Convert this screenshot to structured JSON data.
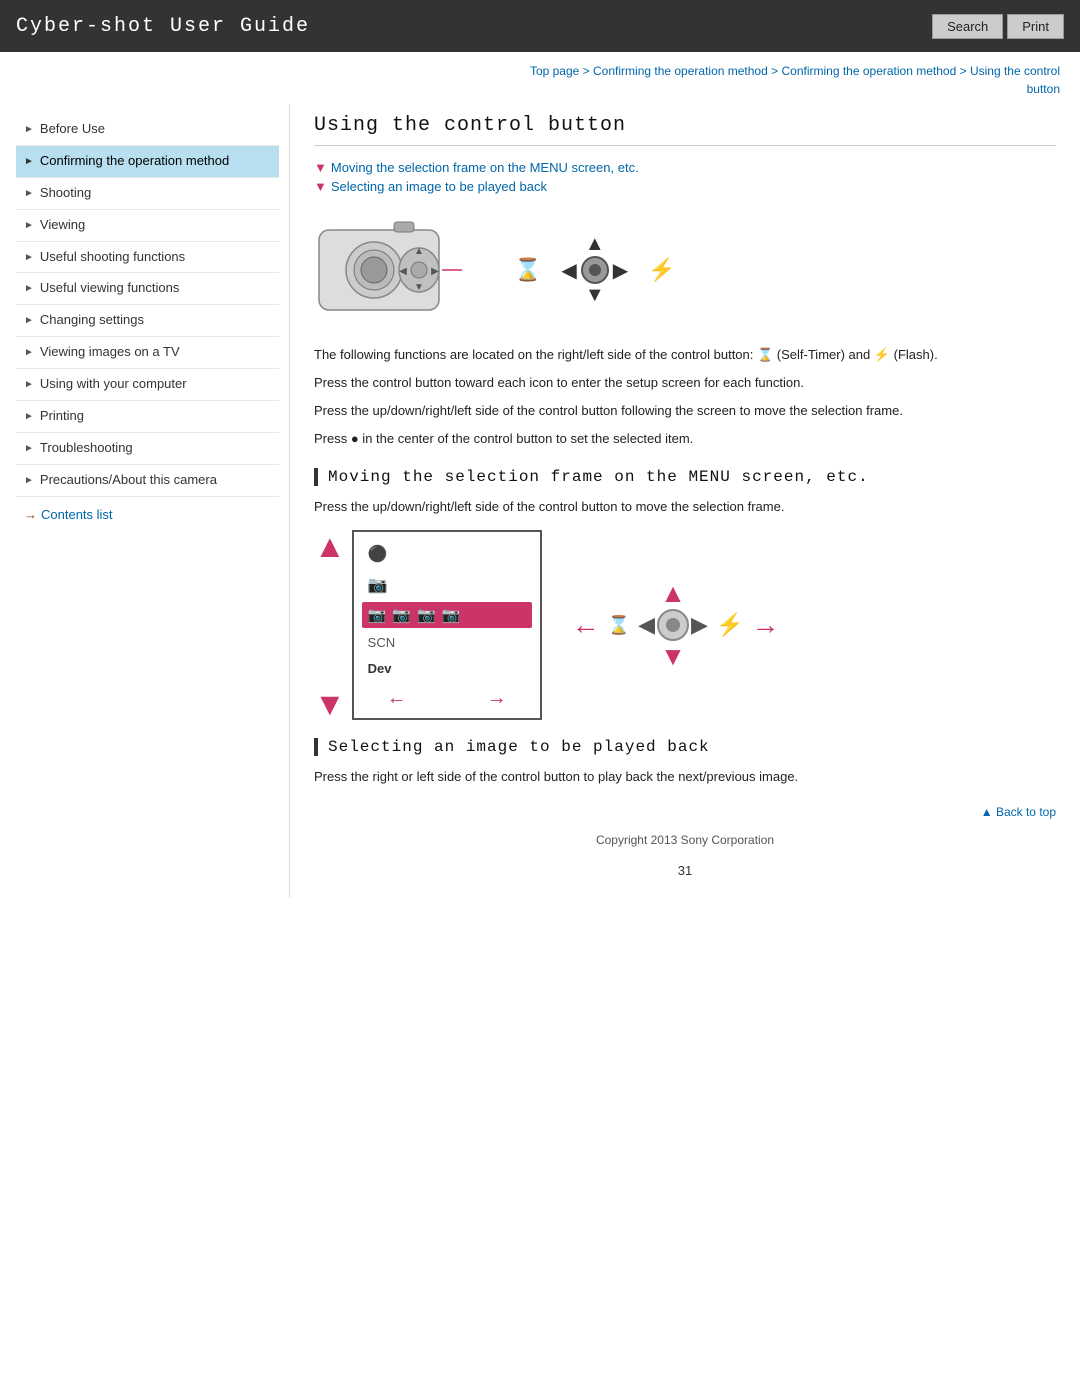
{
  "header": {
    "title": "Cyber-shot User Guide",
    "search_label": "Search",
    "print_label": "Print"
  },
  "breadcrumb": {
    "items": [
      "Top page",
      "Confirming the operation method",
      "Confirming the operation method",
      "Using the control button"
    ]
  },
  "sidebar": {
    "items": [
      {
        "label": "Before Use",
        "active": false
      },
      {
        "label": "Confirming the operation method",
        "active": true
      },
      {
        "label": "Shooting",
        "active": false
      },
      {
        "label": "Viewing",
        "active": false
      },
      {
        "label": "Useful shooting functions",
        "active": false
      },
      {
        "label": "Useful viewing functions",
        "active": false
      },
      {
        "label": "Changing settings",
        "active": false
      },
      {
        "label": "Viewing images on a TV",
        "active": false
      },
      {
        "label": "Using with your computer",
        "active": false
      },
      {
        "label": "Printing",
        "active": false
      },
      {
        "label": "Troubleshooting",
        "active": false
      },
      {
        "label": "Precautions/About this camera",
        "active": false
      }
    ],
    "contents_list_label": "Contents list"
  },
  "content": {
    "page_title": "Using the control button",
    "section_links": [
      "Moving the selection frame on the MENU screen, etc.",
      "Selecting an image to be played back"
    ],
    "desc1": "The following functions are located on the right/left side of the control button: ⌛ (Self-Timer) and ⚡ (Flash).",
    "desc2": "Press the control button toward each icon to enter the setup screen for each function.",
    "desc3": "Press the up/down/right/left side of the control button following the screen to move the selection frame.",
    "desc4": "Press ●  in the center of the control button to set the selected item.",
    "section1_heading": "Moving the selection frame on the MENU screen, etc.",
    "section1_desc": "Press the up/down/right/left side of the control button to move the selection frame.",
    "section2_heading": "Selecting an image to be played back",
    "section2_desc": "Press the right or left side of the control button to play back the next/previous image.",
    "back_to_top": "▲ Back to top",
    "copyright": "Copyright 2013 Sony Corporation",
    "page_number": "31"
  }
}
